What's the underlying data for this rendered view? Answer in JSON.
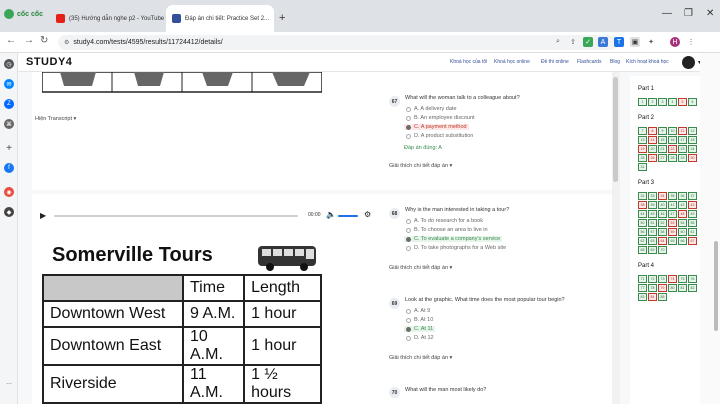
{
  "browser": {
    "brand": "cốc cốc",
    "tabs": [
      {
        "label": "(35) Hướng dẫn nghe p2 - YouTube",
        "icon": "youtube-icon",
        "active": false
      },
      {
        "label": "Đáp án chi tiết: Practice Set 2...",
        "icon": "study4-favicon",
        "active": true
      }
    ],
    "url": "study4.com/tests/4595/results/11724412/details/",
    "profile_initial": "H"
  },
  "header": {
    "logo": "STUDY4",
    "nav": [
      "Khoá học của tôi",
      "Khoá học online",
      "Đề thi online",
      "Flashcards",
      "Blog",
      "Kích hoạt khoá học"
    ]
  },
  "main": {
    "transcript_label": "Hiện Transcript",
    "audio_time": "00:00",
    "tour_table": {
      "title": "Somerville Tours",
      "headers": [
        "",
        "Time",
        "Length"
      ],
      "rows": [
        [
          "Downtown West",
          "9 A.M.",
          "1 hour"
        ],
        [
          "Downtown East",
          "10 A.M.",
          "1 hour"
        ],
        [
          "Riverside",
          "11 A.M.",
          "1 ½ hours"
        ]
      ]
    },
    "questions": [
      {
        "num": "67",
        "text": "What will the woman talk to a colleague about?",
        "options": [
          {
            "label": "A. A delivery date",
            "state": "none"
          },
          {
            "label": "B. An employee discount",
            "state": "none"
          },
          {
            "label": "C. A payment method",
            "state": "wrong"
          },
          {
            "label": "D. A product substitution",
            "state": "none"
          }
        ],
        "answer": "Đáp án đúng: A",
        "explain": "Giải thích chi tiết đáp án"
      },
      {
        "num": "68",
        "text": "Why is the man interested in taking a tour?",
        "options": [
          {
            "label": "A. To do research for a book",
            "state": "none"
          },
          {
            "label": "B. To choose an area to live in",
            "state": "none"
          },
          {
            "label": "C. To evaluate a company's service",
            "state": "correct"
          },
          {
            "label": "D. To take photographs for a Web site",
            "state": "none"
          }
        ],
        "explain": "Giải thích chi tiết đáp án"
      },
      {
        "num": "69",
        "text": "Look at the graphic. What time does the most popular tour begin?",
        "options": [
          {
            "label": "A. At 9",
            "state": "none"
          },
          {
            "label": "B. At 10",
            "state": "none"
          },
          {
            "label": "C. At 11",
            "state": "correct"
          },
          {
            "label": "D. At 12",
            "state": "none"
          }
        ],
        "explain": "Giải thích chi tiết đáp án"
      },
      {
        "num": "70",
        "text": "What will the man most likely do?"
      }
    ]
  },
  "navigator": {
    "parts": [
      {
        "label": "Part 1",
        "cells": [
          {
            "n": "1",
            "s": "c"
          },
          {
            "n": "2",
            "s": "c"
          },
          {
            "n": "3",
            "s": "c"
          },
          {
            "n": "4",
            "s": "c"
          },
          {
            "n": "5",
            "s": "w"
          },
          {
            "n": "6",
            "s": "c"
          }
        ]
      },
      {
        "label": "Part 2",
        "cells": [
          {
            "n": "7",
            "s": "c"
          },
          {
            "n": "8",
            "s": "w"
          },
          {
            "n": "9",
            "s": "c"
          },
          {
            "n": "10",
            "s": "c"
          },
          {
            "n": "11",
            "s": "w"
          },
          {
            "n": "12",
            "s": "c"
          },
          {
            "n": "13",
            "s": "c"
          },
          {
            "n": "14",
            "s": "w"
          },
          {
            "n": "15",
            "s": "c"
          },
          {
            "n": "16",
            "s": "c"
          },
          {
            "n": "17",
            "s": "c"
          },
          {
            "n": "18",
            "s": "c"
          },
          {
            "n": "19",
            "s": "w"
          },
          {
            "n": "20",
            "s": "c"
          },
          {
            "n": "21",
            "s": "c"
          },
          {
            "n": "22",
            "s": "w"
          },
          {
            "n": "23",
            "s": "c"
          },
          {
            "n": "24",
            "s": "c"
          },
          {
            "n": "25",
            "s": "c"
          },
          {
            "n": "26",
            "s": "w"
          },
          {
            "n": "27",
            "s": "c"
          },
          {
            "n": "28",
            "s": "c"
          },
          {
            "n": "29",
            "s": "c"
          },
          {
            "n": "30",
            "s": "w"
          },
          {
            "n": "31",
            "s": "c"
          }
        ]
      },
      {
        "label": "Part 3",
        "cells": [
          {
            "n": "32",
            "s": "c"
          },
          {
            "n": "33",
            "s": "c"
          },
          {
            "n": "34",
            "s": "w"
          },
          {
            "n": "35",
            "s": "c"
          },
          {
            "n": "36",
            "s": "c"
          },
          {
            "n": "37",
            "s": "c"
          },
          {
            "n": "38",
            "s": "w"
          },
          {
            "n": "39",
            "s": "c"
          },
          {
            "n": "40",
            "s": "c"
          },
          {
            "n": "41",
            "s": "c"
          },
          {
            "n": "42",
            "s": "c"
          },
          {
            "n": "43",
            "s": "w"
          },
          {
            "n": "44",
            "s": "c"
          },
          {
            "n": "45",
            "s": "c"
          },
          {
            "n": "46",
            "s": "c"
          },
          {
            "n": "47",
            "s": "c"
          },
          {
            "n": "48",
            "s": "w"
          },
          {
            "n": "49",
            "s": "c"
          },
          {
            "n": "50",
            "s": "c"
          },
          {
            "n": "51",
            "s": "c"
          },
          {
            "n": "52",
            "s": "c"
          },
          {
            "n": "53",
            "s": "w"
          },
          {
            "n": "54",
            "s": "c"
          },
          {
            "n": "55",
            "s": "c"
          },
          {
            "n": "56",
            "s": "c"
          },
          {
            "n": "57",
            "s": "c"
          },
          {
            "n": "58",
            "s": "c"
          },
          {
            "n": "59",
            "s": "w"
          },
          {
            "n": "60",
            "s": "c"
          },
          {
            "n": "61",
            "s": "c"
          },
          {
            "n": "62",
            "s": "c"
          },
          {
            "n": "63",
            "s": "c"
          },
          {
            "n": "64",
            "s": "w"
          },
          {
            "n": "65",
            "s": "c"
          },
          {
            "n": "66",
            "s": "c"
          },
          {
            "n": "67",
            "s": "w"
          },
          {
            "n": "68",
            "s": "c"
          },
          {
            "n": "69",
            "s": "c"
          },
          {
            "n": "70",
            "s": "c"
          }
        ]
      },
      {
        "label": "Part 4",
        "cells": [
          {
            "n": "71",
            "s": "c"
          },
          {
            "n": "72",
            "s": "c"
          },
          {
            "n": "73",
            "s": "c"
          },
          {
            "n": "74",
            "s": "w"
          },
          {
            "n": "75",
            "s": "c"
          },
          {
            "n": "76",
            "s": "c"
          },
          {
            "n": "77",
            "s": "c"
          },
          {
            "n": "78",
            "s": "c"
          },
          {
            "n": "79",
            "s": "w"
          },
          {
            "n": "80",
            "s": "c"
          },
          {
            "n": "81",
            "s": "c"
          },
          {
            "n": "82",
            "s": "c"
          },
          {
            "n": "83",
            "s": "c"
          },
          {
            "n": "84",
            "s": "w"
          },
          {
            "n": "85",
            "s": "c"
          }
        ]
      }
    ]
  }
}
